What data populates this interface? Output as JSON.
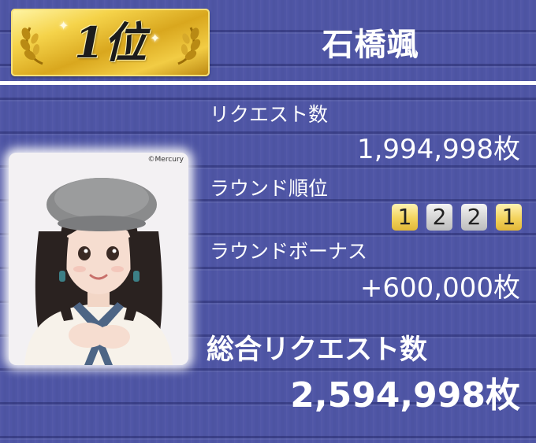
{
  "rank": {
    "text": "1位"
  },
  "member": {
    "name": "石橋颯"
  },
  "photo": {
    "credit": "©Mercury"
  },
  "stats": {
    "requests_label": "リクエスト数",
    "requests_value": "1,994,998枚",
    "round_rank_label": "ラウンド順位",
    "round_ranks": [
      {
        "value": "1",
        "medal": "gold"
      },
      {
        "value": "2",
        "medal": "silver"
      },
      {
        "value": "2",
        "medal": "silver"
      },
      {
        "value": "1",
        "medal": "gold"
      }
    ],
    "bonus_label": "ラウンドボーナス",
    "bonus_value": "+600,000枚"
  },
  "total": {
    "label": "総合リクエスト数",
    "value": "2,594,998枚"
  },
  "colors": {
    "background": "#4f56a6",
    "gold": "#e2b738",
    "silver": "#c8c8c8",
    "text": "#ffffff"
  }
}
